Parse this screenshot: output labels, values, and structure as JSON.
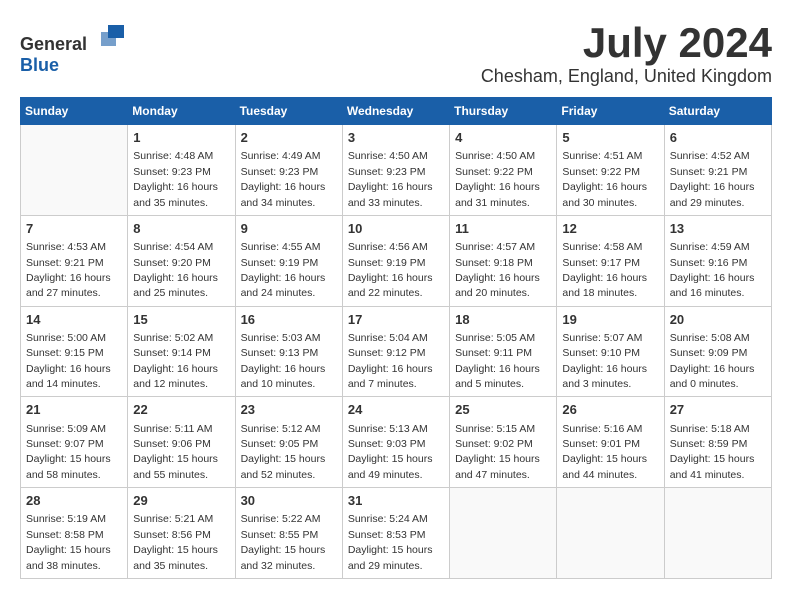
{
  "header": {
    "logo_general": "General",
    "logo_blue": "Blue",
    "month": "July 2024",
    "location": "Chesham, England, United Kingdom"
  },
  "calendar": {
    "days_of_week": [
      "Sunday",
      "Monday",
      "Tuesday",
      "Wednesday",
      "Thursday",
      "Friday",
      "Saturday"
    ],
    "weeks": [
      [
        {
          "day": "",
          "empty": true
        },
        {
          "day": "1",
          "sunrise": "4:48 AM",
          "sunset": "9:23 PM",
          "daylight": "16 hours and 35 minutes."
        },
        {
          "day": "2",
          "sunrise": "4:49 AM",
          "sunset": "9:23 PM",
          "daylight": "16 hours and 34 minutes."
        },
        {
          "day": "3",
          "sunrise": "4:50 AM",
          "sunset": "9:23 PM",
          "daylight": "16 hours and 33 minutes."
        },
        {
          "day": "4",
          "sunrise": "4:50 AM",
          "sunset": "9:22 PM",
          "daylight": "16 hours and 31 minutes."
        },
        {
          "day": "5",
          "sunrise": "4:51 AM",
          "sunset": "9:22 PM",
          "daylight": "16 hours and 30 minutes."
        },
        {
          "day": "6",
          "sunrise": "4:52 AM",
          "sunset": "9:21 PM",
          "daylight": "16 hours and 29 minutes."
        }
      ],
      [
        {
          "day": "7",
          "sunrise": "4:53 AM",
          "sunset": "9:21 PM",
          "daylight": "16 hours and 27 minutes."
        },
        {
          "day": "8",
          "sunrise": "4:54 AM",
          "sunset": "9:20 PM",
          "daylight": "16 hours and 25 minutes."
        },
        {
          "day": "9",
          "sunrise": "4:55 AM",
          "sunset": "9:19 PM",
          "daylight": "16 hours and 24 minutes."
        },
        {
          "day": "10",
          "sunrise": "4:56 AM",
          "sunset": "9:19 PM",
          "daylight": "16 hours and 22 minutes."
        },
        {
          "day": "11",
          "sunrise": "4:57 AM",
          "sunset": "9:18 PM",
          "daylight": "16 hours and 20 minutes."
        },
        {
          "day": "12",
          "sunrise": "4:58 AM",
          "sunset": "9:17 PM",
          "daylight": "16 hours and 18 minutes."
        },
        {
          "day": "13",
          "sunrise": "4:59 AM",
          "sunset": "9:16 PM",
          "daylight": "16 hours and 16 minutes."
        }
      ],
      [
        {
          "day": "14",
          "sunrise": "5:00 AM",
          "sunset": "9:15 PM",
          "daylight": "16 hours and 14 minutes."
        },
        {
          "day": "15",
          "sunrise": "5:02 AM",
          "sunset": "9:14 PM",
          "daylight": "16 hours and 12 minutes."
        },
        {
          "day": "16",
          "sunrise": "5:03 AM",
          "sunset": "9:13 PM",
          "daylight": "16 hours and 10 minutes."
        },
        {
          "day": "17",
          "sunrise": "5:04 AM",
          "sunset": "9:12 PM",
          "daylight": "16 hours and 7 minutes."
        },
        {
          "day": "18",
          "sunrise": "5:05 AM",
          "sunset": "9:11 PM",
          "daylight": "16 hours and 5 minutes."
        },
        {
          "day": "19",
          "sunrise": "5:07 AM",
          "sunset": "9:10 PM",
          "daylight": "16 hours and 3 minutes."
        },
        {
          "day": "20",
          "sunrise": "5:08 AM",
          "sunset": "9:09 PM",
          "daylight": "16 hours and 0 minutes."
        }
      ],
      [
        {
          "day": "21",
          "sunrise": "5:09 AM",
          "sunset": "9:07 PM",
          "daylight": "15 hours and 58 minutes."
        },
        {
          "day": "22",
          "sunrise": "5:11 AM",
          "sunset": "9:06 PM",
          "daylight": "15 hours and 55 minutes."
        },
        {
          "day": "23",
          "sunrise": "5:12 AM",
          "sunset": "9:05 PM",
          "daylight": "15 hours and 52 minutes."
        },
        {
          "day": "24",
          "sunrise": "5:13 AM",
          "sunset": "9:03 PM",
          "daylight": "15 hours and 49 minutes."
        },
        {
          "day": "25",
          "sunrise": "5:15 AM",
          "sunset": "9:02 PM",
          "daylight": "15 hours and 47 minutes."
        },
        {
          "day": "26",
          "sunrise": "5:16 AM",
          "sunset": "9:01 PM",
          "daylight": "15 hours and 44 minutes."
        },
        {
          "day": "27",
          "sunrise": "5:18 AM",
          "sunset": "8:59 PM",
          "daylight": "15 hours and 41 minutes."
        }
      ],
      [
        {
          "day": "28",
          "sunrise": "5:19 AM",
          "sunset": "8:58 PM",
          "daylight": "15 hours and 38 minutes."
        },
        {
          "day": "29",
          "sunrise": "5:21 AM",
          "sunset": "8:56 PM",
          "daylight": "15 hours and 35 minutes."
        },
        {
          "day": "30",
          "sunrise": "5:22 AM",
          "sunset": "8:55 PM",
          "daylight": "15 hours and 32 minutes."
        },
        {
          "day": "31",
          "sunrise": "5:24 AM",
          "sunset": "8:53 PM",
          "daylight": "15 hours and 29 minutes."
        },
        {
          "day": "",
          "empty": true
        },
        {
          "day": "",
          "empty": true
        },
        {
          "day": "",
          "empty": true
        }
      ]
    ]
  }
}
